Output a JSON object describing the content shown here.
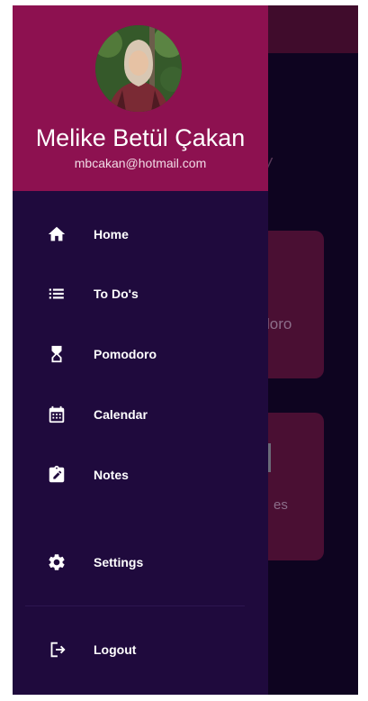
{
  "user": {
    "name": "Melike Betül Çakan",
    "email": "mbcakan@hotmail.com"
  },
  "drawer": {
    "items": [
      {
        "label": "Home",
        "icon": "home-icon"
      },
      {
        "label": "To Do's",
        "icon": "list-icon"
      },
      {
        "label": "Pomodoro",
        "icon": "hourglass-icon"
      },
      {
        "label": "Calendar",
        "icon": "calendar-icon"
      },
      {
        "label": "Notes",
        "icon": "note-edit-icon"
      }
    ],
    "settings": {
      "label": "Settings",
      "icon": "gear-icon"
    },
    "logout": {
      "label": "Logout",
      "icon": "logout-icon"
    }
  },
  "background": {
    "card_one_label": "loro",
    "card_two_label": "es",
    "title_fragment": "/"
  },
  "colors": {
    "header": "#8d1150",
    "drawer": "#1f0a3d",
    "text": "#ffffff"
  }
}
